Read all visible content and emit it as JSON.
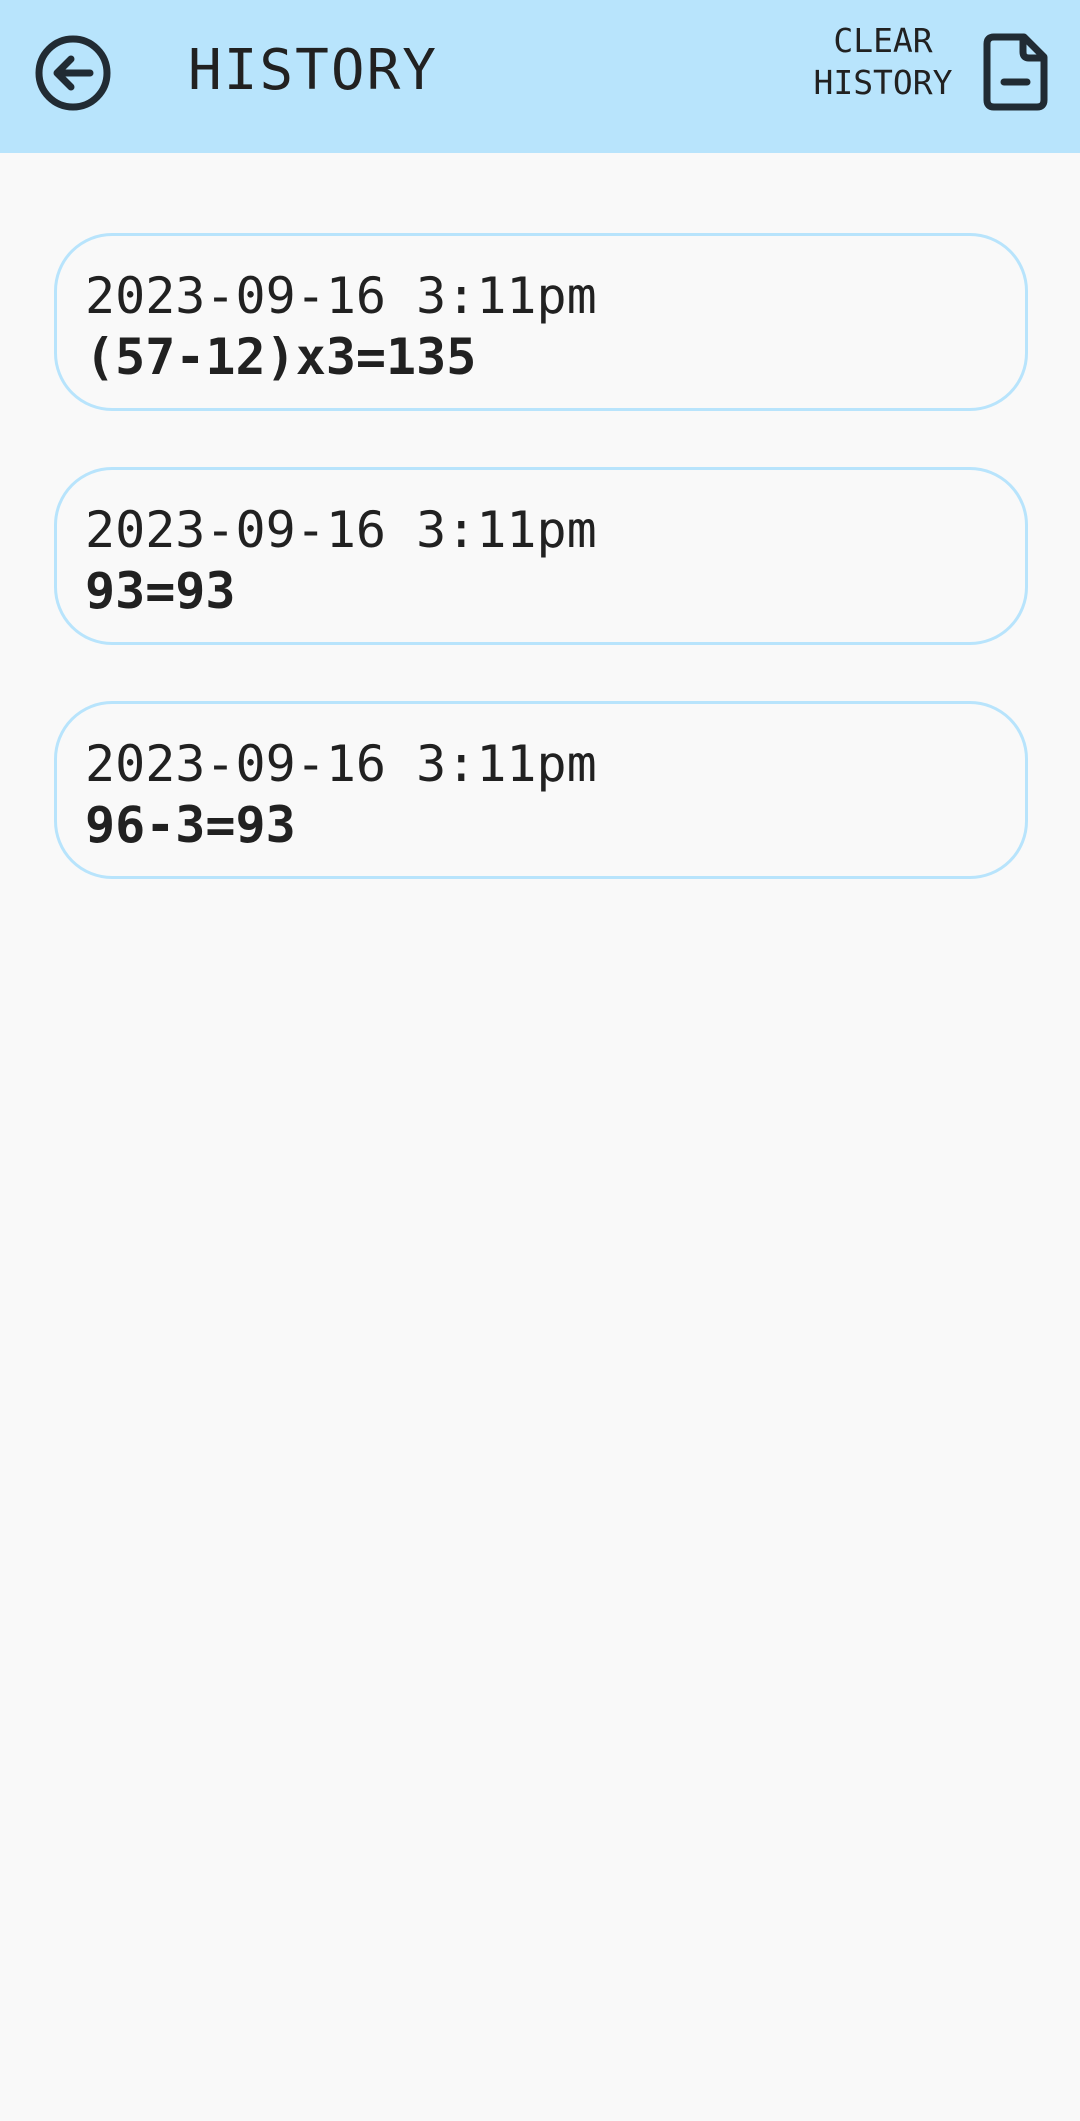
{
  "header": {
    "title": "HISTORY",
    "back_icon": "arrow-left-circle-icon",
    "clear_label_line1": "CLEAR",
    "clear_label_line2": "HISTORY",
    "clear_icon": "document-minus-icon"
  },
  "colors": {
    "app_bar": "#b8e4fc",
    "background": "#f9f9f9",
    "text": "#212121",
    "card_border": "#b8e4fc"
  },
  "history": [
    {
      "time": "2023-09-16 3:11pm",
      "expression": "(57-12)x3=135"
    },
    {
      "time": "2023-09-16 3:11pm",
      "expression": "93=93"
    },
    {
      "time": "2023-09-16 3:11pm",
      "expression": "96-3=93"
    }
  ]
}
